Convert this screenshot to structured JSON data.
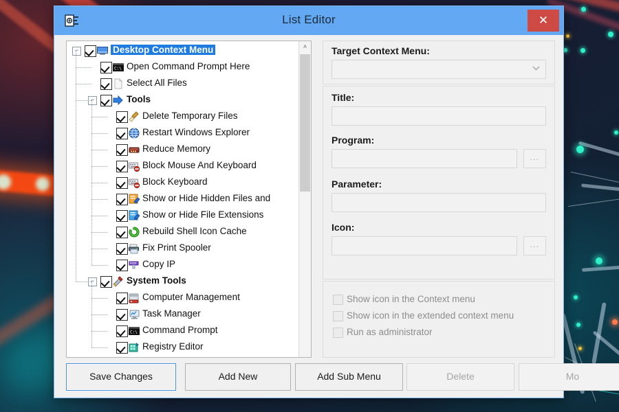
{
  "window": {
    "title": "List Editor",
    "title_icon": "list-editor-icon",
    "close_label": "✕"
  },
  "tree": {
    "items": [
      {
        "label": "Desktop Context Menu",
        "depth": 0,
        "checked": true,
        "expanded": true,
        "selected": true,
        "bold": true,
        "icon": "monitor-icon"
      },
      {
        "label": "Open Command Prompt Here",
        "depth": 1,
        "checked": true,
        "icon": "cmd-icon"
      },
      {
        "label": "Select All Files",
        "depth": 1,
        "checked": true,
        "icon": "document-icon"
      },
      {
        "label": "Tools",
        "depth": 1,
        "checked": true,
        "expanded": true,
        "bold": true,
        "icon": "blue-arrow-icon"
      },
      {
        "label": "Delete Temporary Files",
        "depth": 2,
        "checked": true,
        "icon": "broom-icon"
      },
      {
        "label": "Restart Windows Explorer",
        "depth": 2,
        "checked": true,
        "icon": "globe-icon"
      },
      {
        "label": "Reduce Memory",
        "depth": 2,
        "checked": true,
        "icon": "memory-chip-icon"
      },
      {
        "label": "Block Mouse And Keyboard",
        "depth": 2,
        "checked": true,
        "icon": "keyboard-block-icon"
      },
      {
        "label": "Block Keyboard",
        "depth": 2,
        "checked": true,
        "icon": "keyboard-block-icon"
      },
      {
        "label": "Show or Hide Hidden Files and",
        "depth": 2,
        "checked": true,
        "icon": "orange-edit-icon"
      },
      {
        "label": "Show or Hide File Extensions",
        "depth": 2,
        "checked": true,
        "icon": "blue-edit-icon"
      },
      {
        "label": "Rebuild Shell Icon Cache",
        "depth": 2,
        "checked": true,
        "icon": "green-refresh-icon"
      },
      {
        "label": "Fix Print Spooler",
        "depth": 2,
        "checked": true,
        "icon": "printer-icon"
      },
      {
        "label": "Copy IP",
        "depth": 2,
        "checked": true,
        "icon": "network-icon"
      },
      {
        "label": "System Tools",
        "depth": 1,
        "checked": true,
        "expanded": true,
        "bold": true,
        "icon": "tools-icon"
      },
      {
        "label": "Computer Management",
        "depth": 2,
        "checked": true,
        "icon": "server-icon"
      },
      {
        "label": "Task Manager",
        "depth": 2,
        "checked": true,
        "icon": "monitor-chart-icon"
      },
      {
        "label": "Command Prompt",
        "depth": 2,
        "checked": true,
        "icon": "cmd-icon"
      },
      {
        "label": "Registry Editor",
        "depth": 2,
        "checked": true,
        "icon": "registry-icon"
      }
    ]
  },
  "form": {
    "target_context_menu": {
      "label": "Target Context Menu:",
      "value": "",
      "placeholder": ""
    },
    "title": {
      "label": "Title:",
      "value": "",
      "placeholder": ""
    },
    "program": {
      "label": "Program:",
      "value": "",
      "placeholder": "",
      "browse_label": "..."
    },
    "parameter": {
      "label": "Parameter:",
      "value": "",
      "placeholder": ""
    },
    "icon": {
      "label": "Icon:",
      "value": "",
      "placeholder": "",
      "browse_label": "..."
    },
    "checkboxes": [
      {
        "label": "Show icon in the Context menu",
        "checked": false
      },
      {
        "label": "Show icon in the extended context menu",
        "checked": false
      },
      {
        "label": "Run as administrator",
        "checked": false
      }
    ]
  },
  "buttons": [
    {
      "label": "Save Changes",
      "state": "primary"
    },
    {
      "label": "Add New",
      "state": "normal"
    },
    {
      "label": "Add Sub Menu",
      "state": "normal"
    },
    {
      "label": "Delete",
      "state": "disabled"
    },
    {
      "label": "Mo",
      "state": "disabled"
    }
  ],
  "colors": {
    "titlebar": "#62a8f2",
    "close": "#cd4a45",
    "selection": "#1e7ce0",
    "window_bg": "#f0f0f0",
    "border": "#7eb2ea"
  },
  "scrollbar": {
    "up_arrow": "˄"
  }
}
